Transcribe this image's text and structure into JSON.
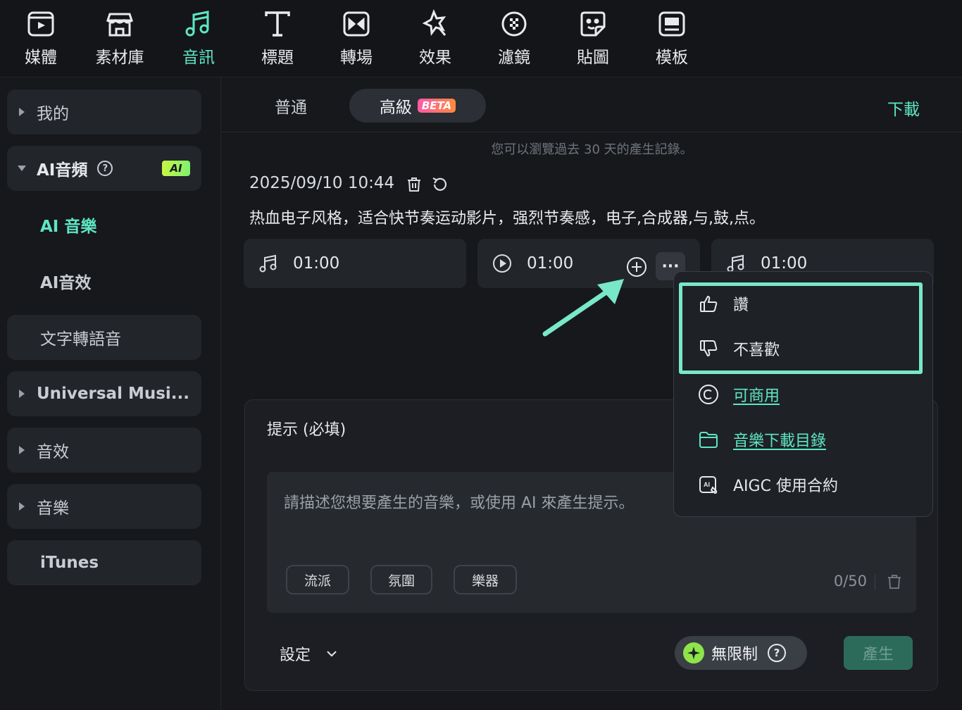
{
  "toolbar": {
    "items": [
      {
        "label": "媒體",
        "icon": "media-icon"
      },
      {
        "label": "素材庫",
        "icon": "store-icon"
      },
      {
        "label": "音訊",
        "icon": "music-note-icon"
      },
      {
        "label": "標題",
        "icon": "title-icon"
      },
      {
        "label": "轉場",
        "icon": "transition-icon"
      },
      {
        "label": "效果",
        "icon": "effects-icon"
      },
      {
        "label": "濾鏡",
        "icon": "filter-icon"
      },
      {
        "label": "貼圖",
        "icon": "sticker-icon"
      },
      {
        "label": "模板",
        "icon": "template-icon"
      }
    ],
    "active_index": 2
  },
  "sidebar": {
    "items": [
      {
        "label": "我的"
      },
      {
        "label": "AI音頻",
        "badge": "AI"
      },
      {
        "label": "AI 音樂"
      },
      {
        "label": "AI音效"
      },
      {
        "label": "文字轉語音"
      },
      {
        "label": "Universal Musi..."
      },
      {
        "label": "音效"
      },
      {
        "label": "音樂"
      },
      {
        "label": "iTunes"
      }
    ]
  },
  "tabs": {
    "basic": "普通",
    "advanced": "高級",
    "beta": "BETA",
    "download": "下載"
  },
  "history": {
    "note": "您可以瀏覽過去 30 天的產生記錄。",
    "timestamp": "2025/09/10 10:44",
    "prompt": "热血电子风格，适合快节奏运动影片，强烈节奏感，电子,合成器,与,鼓,点。"
  },
  "tracks": [
    {
      "duration": "01:00",
      "icon": "music-note-icon"
    },
    {
      "duration": "01:00",
      "icon": "play-icon"
    },
    {
      "duration": "01:00",
      "icon": "music-note-icon"
    }
  ],
  "menu": {
    "like": "讚",
    "dislike": "不喜歡",
    "commercial": "可商用",
    "download_dir": "音樂下載目錄",
    "aigc": "AIGC 使用合約"
  },
  "prompt_panel": {
    "title": "提示 (必填)",
    "placeholder": "請描述您想要產生的音樂，或使用 AI 來產生提示。",
    "chips": [
      "流派",
      "氛圍",
      "樂器"
    ],
    "count": "0/50",
    "settings": "設定",
    "unlimited": "無限制",
    "generate": "產生"
  },
  "colors": {
    "accent": "#5ee6c4",
    "highlight_border": "#78e8c8",
    "background": "#16181c",
    "panel": "#1c1e23"
  }
}
